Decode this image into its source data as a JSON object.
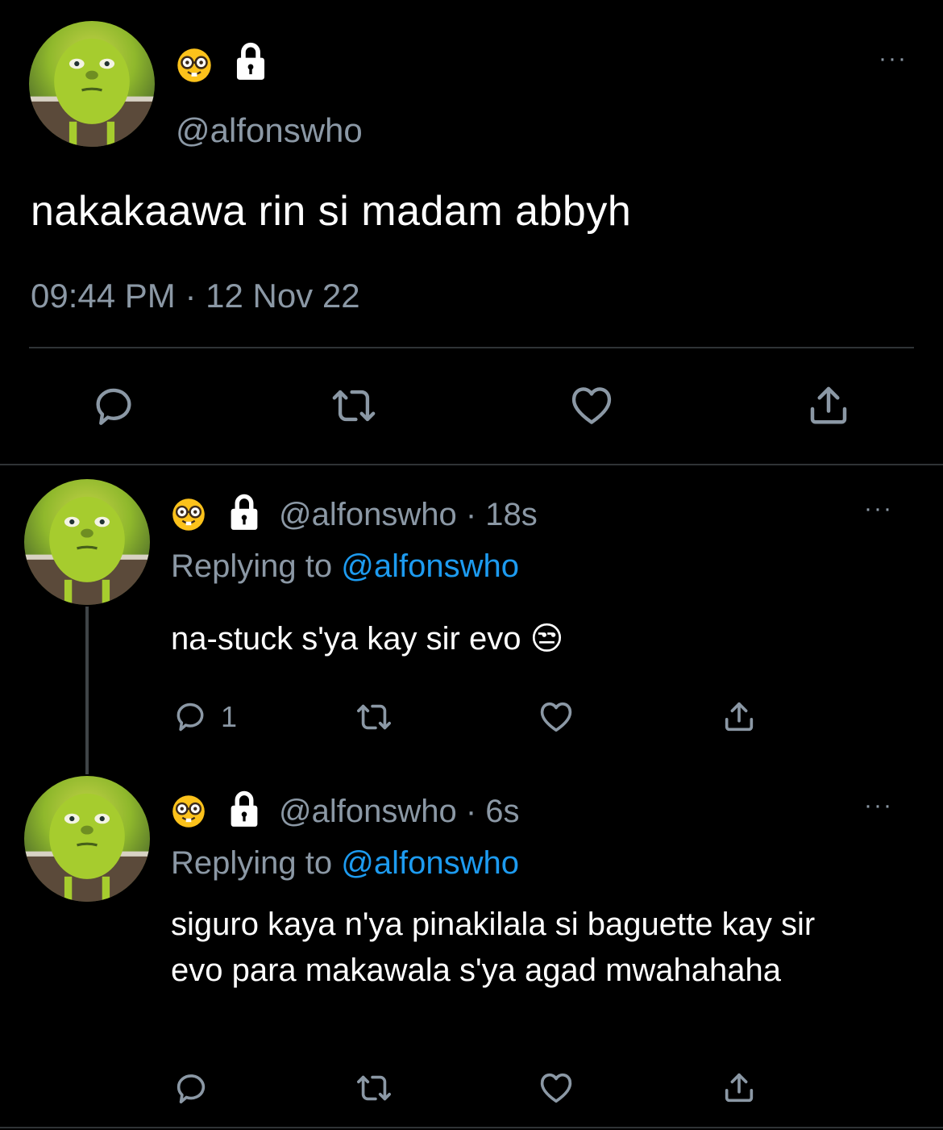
{
  "main_tweet": {
    "handle": "@alfonswho",
    "text": "nakakaawa rin si madam abbyh",
    "timestamp": "09:44 PM · 12 Nov 22",
    "more_label": "···",
    "actions": [
      "reply-icon",
      "retweet-icon",
      "like-icon",
      "share-icon"
    ]
  },
  "replies": [
    {
      "handle_time": "@alfonswho · 18s",
      "replying_prefix": "Replying to ",
      "replying_mention": "@alfonswho",
      "text": "na-stuck s'ya kay sir evo 😒",
      "reply_count": "1",
      "more_label": "···"
    },
    {
      "handle_time": "@alfonswho · 6s",
      "replying_prefix": "Replying to ",
      "replying_mention": "@alfonswho",
      "text": "siguro kaya n'ya pinakilala si baguette kay sir evo para makawala s'ya agad mwahahaha",
      "reply_count": "",
      "more_label": "···"
    }
  ],
  "colors": {
    "background": "#000000",
    "secondary_text": "#8b98a5",
    "mention": "#1d9bf0",
    "divider": "#2f3336"
  }
}
